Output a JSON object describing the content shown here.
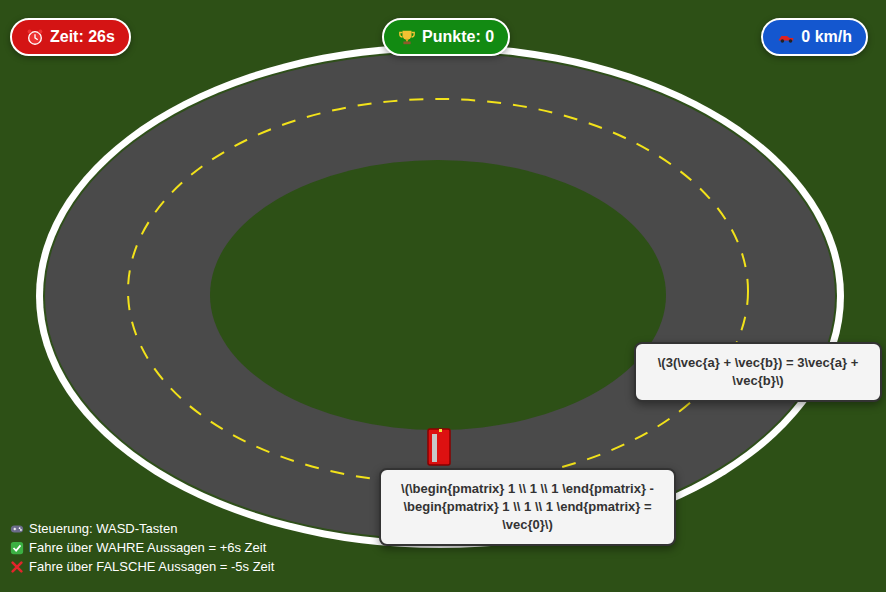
{
  "hud": {
    "time": "Zeit: 26s",
    "score": "Punkte: 0",
    "speed": "0 km/h"
  },
  "cards": [
    {
      "text": "\\(3(\\vec{a} + \\vec{b}) = 3\\vec{a} + \\vec{b}\\)"
    },
    {
      "text": "\\(\\begin{pmatrix} 1 \\\\ 1 \\\\ 1 \\end{pmatrix} - \\begin{pmatrix} 1 \\\\ 1 \\\\ 1 \\end{pmatrix} = \\vec{0}\\)"
    }
  ],
  "instructions": [
    {
      "text": "Steuerung: WASD-Tasten",
      "kind": "controls"
    },
    {
      "text": "Fahre über WAHRE Aussagen = +6s Zeit",
      "kind": "true"
    },
    {
      "text": "Fahre über FALSCHE Aussagen = -5s Zeit",
      "kind": "false"
    }
  ]
}
